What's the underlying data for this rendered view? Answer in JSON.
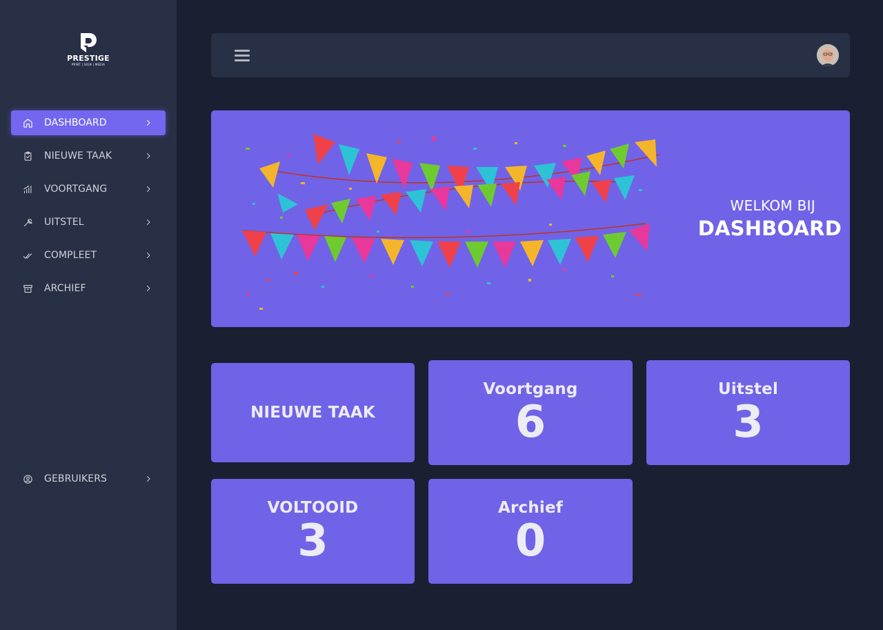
{
  "brand": {
    "name": "PRESTIGE",
    "tagline": "PRINT | SIGN | MEDIA"
  },
  "sidebar": {
    "items": [
      {
        "label": "DASHBOARD",
        "icon": "home-icon",
        "active": true
      },
      {
        "label": "NIEUWE TAAK",
        "icon": "clipboard-check-icon",
        "active": false
      },
      {
        "label": "VOORTGANG",
        "icon": "bar-chart-icon",
        "active": false
      },
      {
        "label": "UITSTEL",
        "icon": "tool-icon",
        "active": false
      },
      {
        "label": "COMPLEET",
        "icon": "check-double-icon",
        "active": false
      },
      {
        "label": "ARCHIEF",
        "icon": "archive-icon",
        "active": false
      }
    ],
    "bottom_items": [
      {
        "label": "GEBRUIKERS",
        "icon": "user-circle-icon"
      }
    ]
  },
  "topbar": {
    "menu_icon": "hamburger-menu-icon",
    "avatar_icon": "user-avatar"
  },
  "banner": {
    "welcome": "WELKOM BIJ",
    "title": "DASHBOARD",
    "art": "bunting-flags-confetti"
  },
  "cards": {
    "new_task": {
      "title": "NIEUWE TAAK"
    },
    "progress": {
      "title": "Voortgang",
      "value": "6"
    },
    "delay": {
      "title": "Uitstel",
      "value": "3"
    },
    "completed": {
      "title": "VOLTOOID",
      "value": "3"
    },
    "archive": {
      "title": "Archief",
      "value": "0"
    }
  },
  "colors": {
    "background": "#1a1f32",
    "sidebar": "#283046",
    "accent": "#7367f0",
    "card": "#7063e7"
  }
}
